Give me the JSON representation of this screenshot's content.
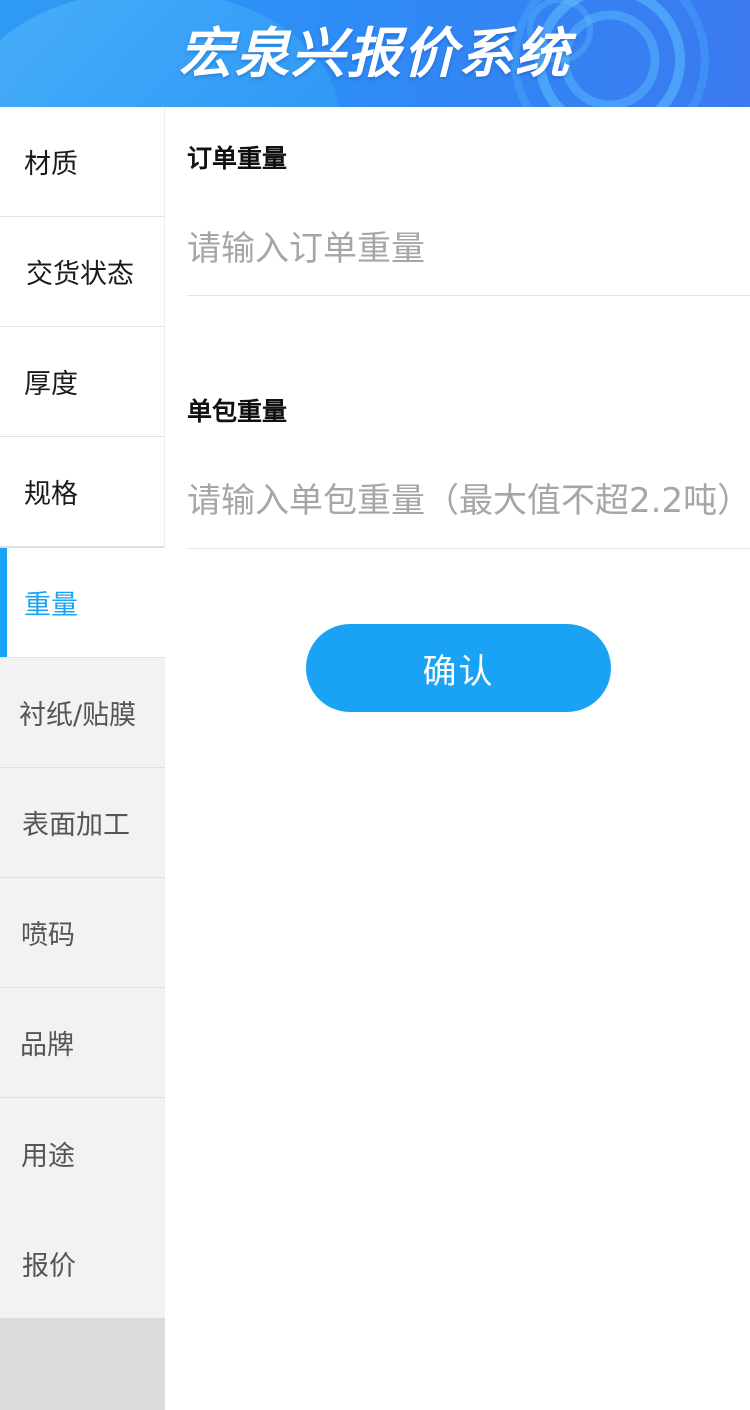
{
  "header": {
    "title": "宏泉兴报价系统"
  },
  "sidebar": {
    "items": [
      {
        "label": "材质",
        "state": "done"
      },
      {
        "label": "交货状态",
        "state": "done"
      },
      {
        "label": "厚度",
        "state": "done"
      },
      {
        "label": "规格",
        "state": "done"
      },
      {
        "label": "重量",
        "state": "active"
      },
      {
        "label": "衬纸/贴膜",
        "state": "pending"
      },
      {
        "label": "表面加工",
        "state": "pending"
      },
      {
        "label": "喷码",
        "state": "pending"
      },
      {
        "label": "品牌",
        "state": "pending"
      },
      {
        "label": "用途",
        "state": "pending"
      },
      {
        "label": "报价",
        "state": "pending"
      }
    ]
  },
  "form": {
    "order_weight": {
      "label": "订单重量",
      "placeholder": "请输入订单重量",
      "value": ""
    },
    "package_weight": {
      "label": "单包重量",
      "placeholder": "请输入单包重量（最大值不超2.2吨）",
      "value": ""
    },
    "confirm_label": "确认"
  },
  "colors": {
    "accent": "#1aa3f5",
    "header_gradient_start": "#2f9bf5",
    "header_gradient_end": "#3b7af0",
    "sidebar_pending_bg": "#f2f2f2",
    "sidebar_bottom_bg": "#dcdcdc"
  }
}
